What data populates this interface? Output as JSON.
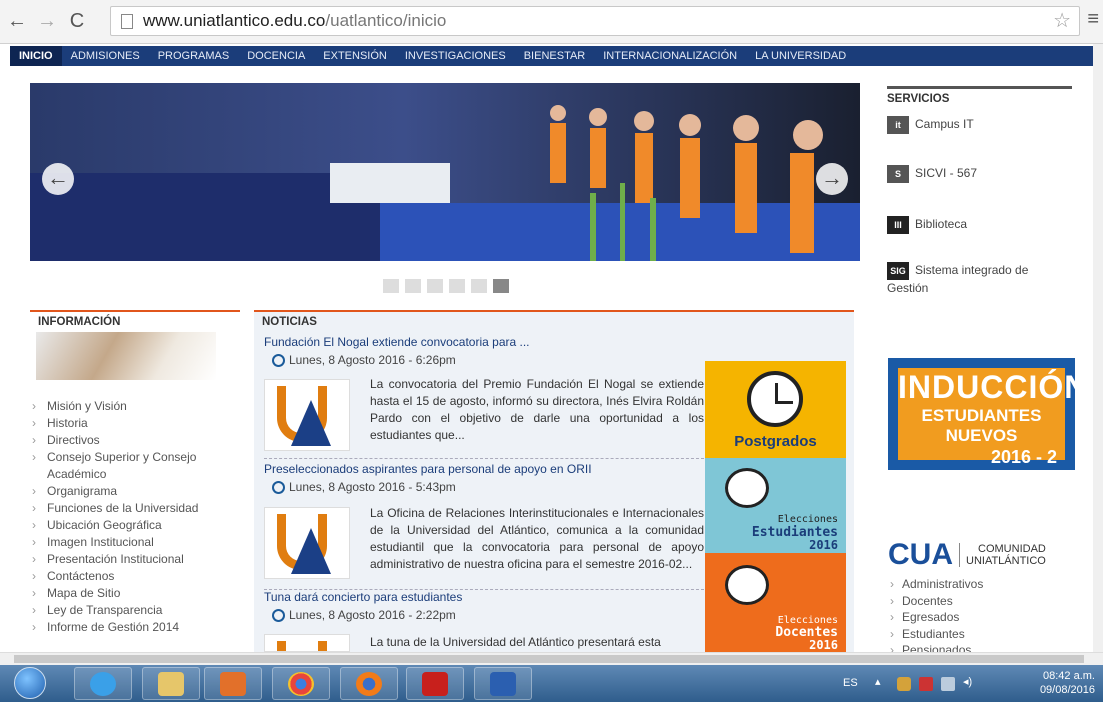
{
  "browser": {
    "url_host": "www.uniatlantico.edu.co",
    "url_path": "/uatlantico/inicio"
  },
  "topnav": [
    "INICIO",
    "ADMISIONES",
    "PROGRAMAS",
    "DOCENCIA",
    "EXTENSIÓN",
    "INVESTIGACIONES",
    "BIENESTAR",
    "INTERNACIONALIZACIÓN",
    "LA UNIVERSIDAD"
  ],
  "slider": {
    "active_index": 5,
    "count": 6
  },
  "servicios": {
    "title": "SERVICIOS",
    "items": [
      {
        "icon_text": "it",
        "label": "Campus IT"
      },
      {
        "icon_text": "S",
        "label": "SICVI - 567"
      },
      {
        "icon_text": "III",
        "label": "Biblioteca"
      },
      {
        "icon_text": "SIG",
        "label": "Sistema integrado de Gestión"
      }
    ]
  },
  "induccion": {
    "line1": "INDUCCIÓN",
    "line2": "ESTUDIANTES NUEVOS",
    "line3": "2016 - 2"
  },
  "comunidad": {
    "logo": "CUA",
    "name_1": "COMUNIDAD",
    "name_2": "UNIATLÁNTICO",
    "links": [
      "Administrativos",
      "Docentes",
      "Egresados",
      "Estudiantes",
      "Pensionados"
    ]
  },
  "informacion": {
    "title": "INFORMACIÓN",
    "items": [
      "Misión y Visión",
      "Historia",
      "Directivos",
      "Consejo Superior y Consejo Académico",
      "Organigrama",
      "Funciones de la Universidad",
      "Ubicación Geográfica",
      "Imagen Institucional",
      "Presentación Institucional",
      "Contáctenos",
      "Mapa de Sitio",
      "Ley de Transparencia",
      "Informe de Gestión 2014"
    ]
  },
  "noticias": {
    "title": "NOTICIAS",
    "items": [
      {
        "title": "Fundación El Nogal extiende convocatoria para ...",
        "date": "Lunes, 8 Agosto 2016 - 6:26pm",
        "body": "La convocatoria del Premio Fundación El Nogal se extiende hasta el 15 de agosto, informó su directora, Inés Elvira Roldán Pardo con el objetivo de darle una oportunidad a los estudiantes que..."
      },
      {
        "title": "Preseleccionados aspirantes para personal de apoyo en ORII",
        "date": "Lunes, 8 Agosto 2016 - 5:43pm",
        "body": "La Oficina de Relaciones Interinstitucionales e Internacionales de la Universidad del Atlántico, comunica a la comunidad estudiantil que la convocatoria para personal de apoyo administrativo de nuestra oficina para el semestre 2016-02..."
      },
      {
        "title": "Tuna dará concierto para estudiantes",
        "date": "Lunes, 8 Agosto 2016 - 2:22pm",
        "body": "La tuna de la Universidad del Atlántico presentará esta"
      }
    ]
  },
  "tiles": {
    "postgrados": "Postgrados",
    "est_1": "Elecciones",
    "est_2": "Estudiantes",
    "est_3": "2016",
    "doc_1": "Elecciones",
    "doc_2": "Docentes",
    "doc_3": "2016"
  },
  "taskbar": {
    "lang": "ES",
    "time": "08:42 a.m.",
    "date": "09/08/2016"
  },
  "colors": {
    "nav": "#1b3d7a",
    "accent_orange": "#e1561c",
    "tile_yellow": "#f5b400",
    "tile_blue": "#7fc6d6",
    "tile_orange": "#ee6c1c"
  }
}
